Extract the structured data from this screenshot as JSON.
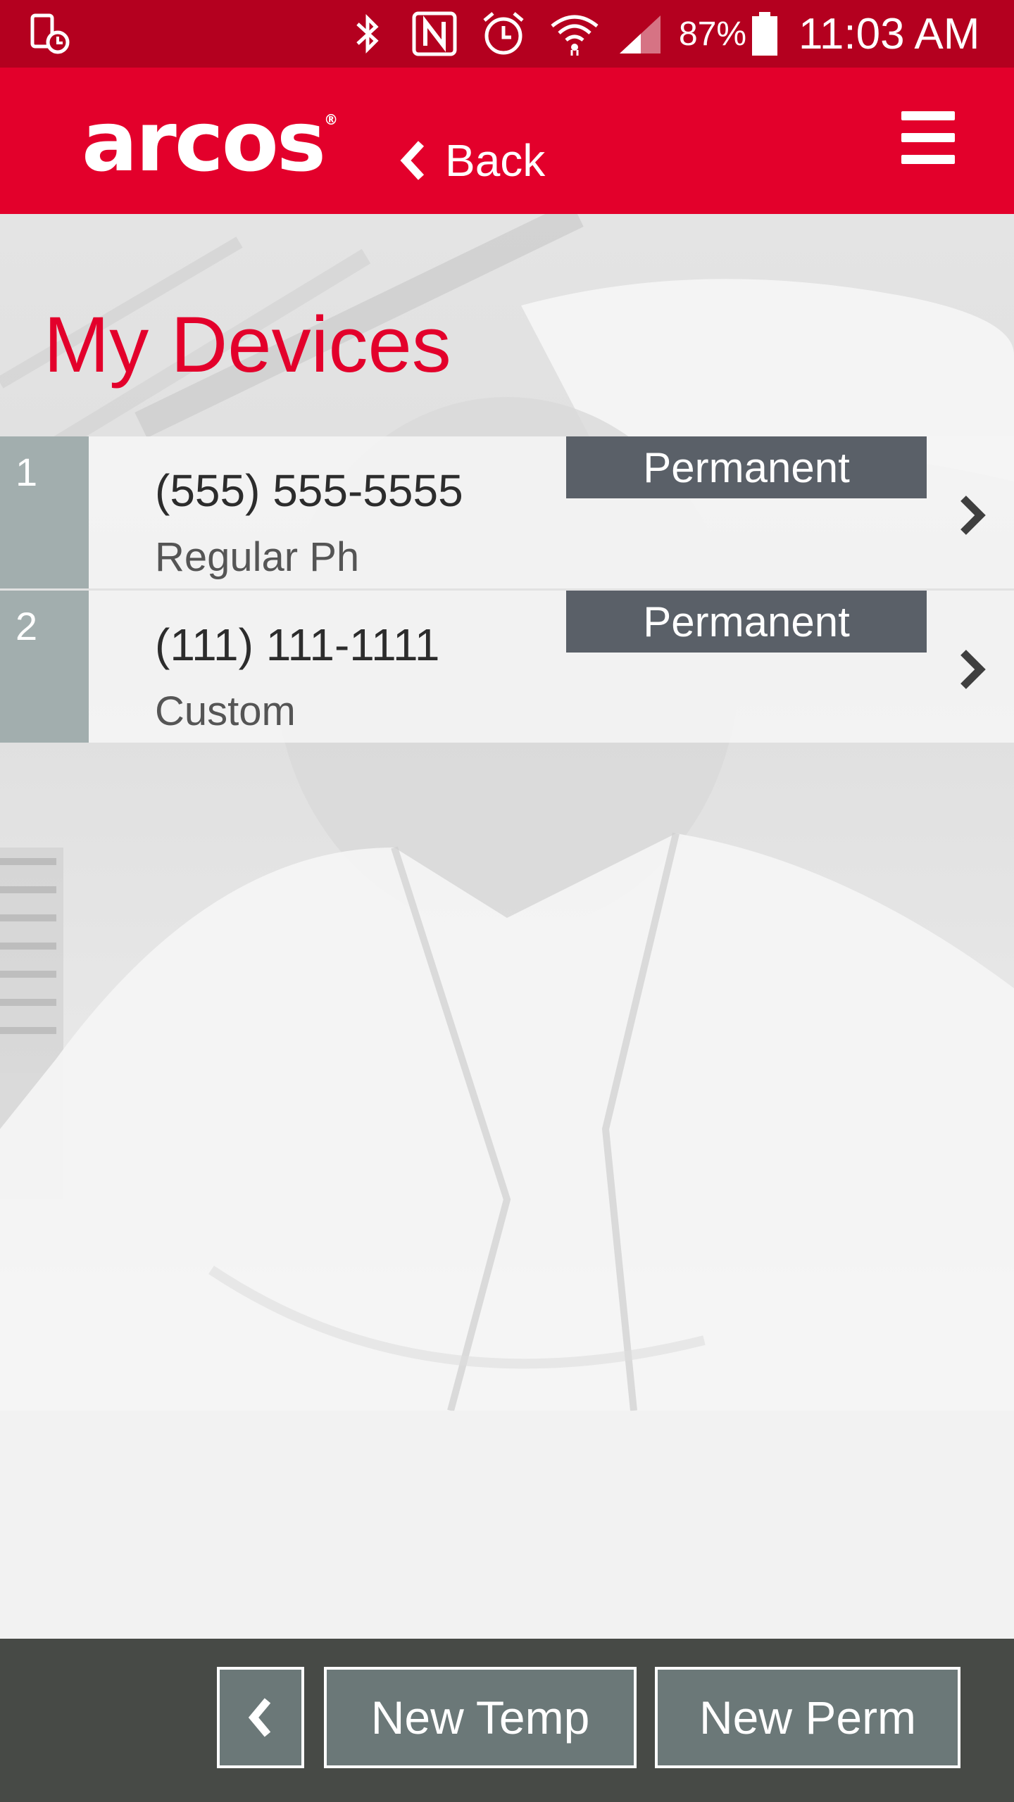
{
  "status_bar": {
    "battery_percent": "87%",
    "time": "11:03 AM",
    "icons": [
      "device-timer-icon",
      "bluetooth-icon",
      "nfc-icon",
      "alarm-icon",
      "wifi-icon",
      "signal-icon",
      "battery-icon"
    ]
  },
  "header": {
    "logo_text": "arcos",
    "logo_mark": "®",
    "back_label": "Back"
  },
  "page": {
    "title": "My Devices"
  },
  "devices": [
    {
      "index": "1",
      "phone": "(555) 555-5555",
      "type": "Regular Ph",
      "status": "Permanent"
    },
    {
      "index": "2",
      "phone": "(111) 111-1111",
      "type": "Custom",
      "status": "Permanent"
    }
  ],
  "bottom_bar": {
    "new_temp_label": "New Temp",
    "new_perm_label": "New Perm"
  },
  "colors": {
    "brand_red": "#e3002b",
    "status_bar": "#b4001f",
    "badge": "#5a6068",
    "index_cell": "#a2aeae",
    "bottom_bar": "#474a46",
    "bottom_button": "#6b7878"
  }
}
